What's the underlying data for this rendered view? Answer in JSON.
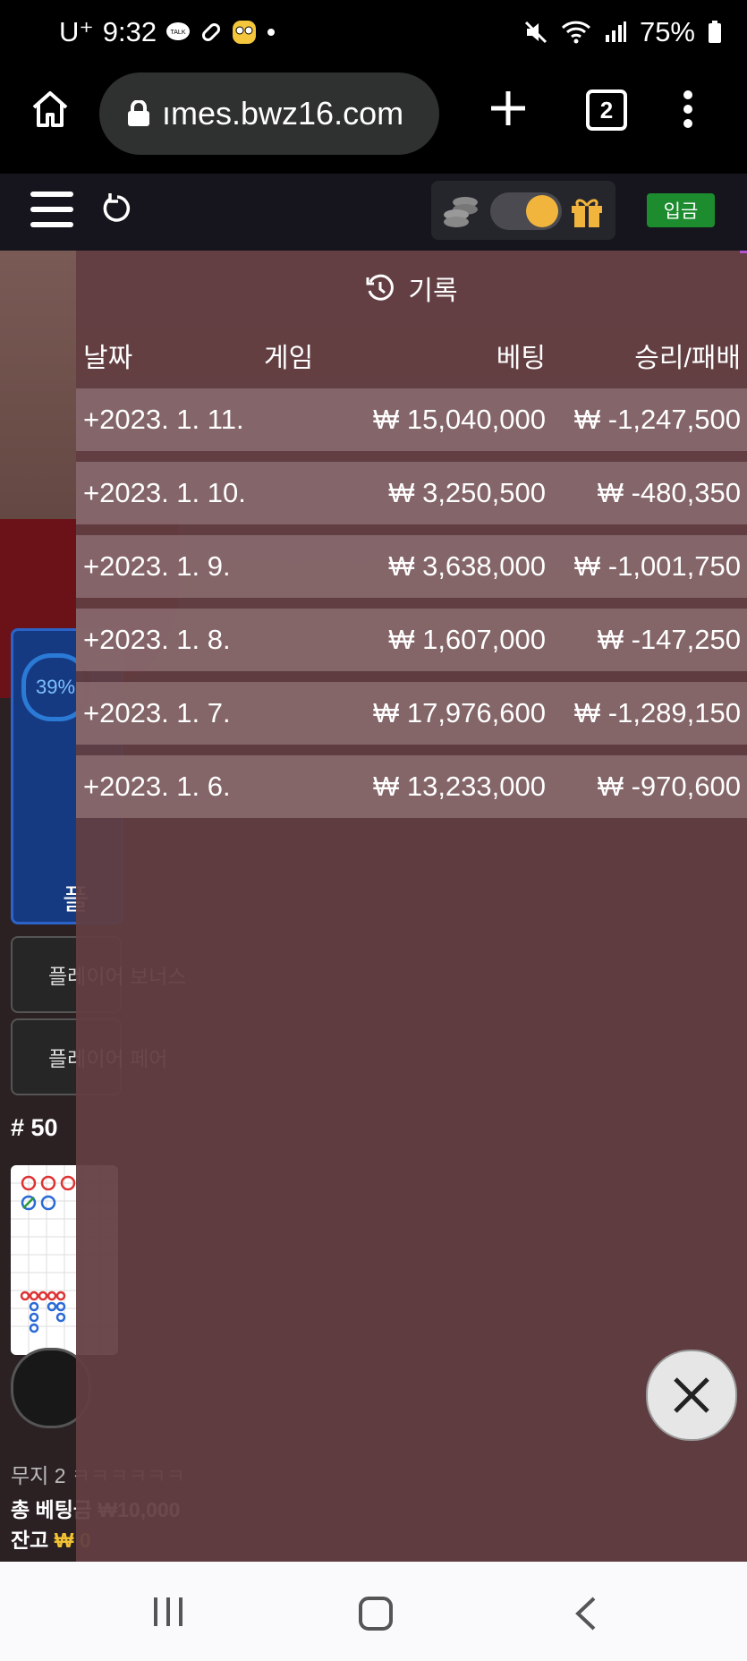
{
  "status_bar": {
    "carrier": "U⁺",
    "time": "9:32",
    "battery": "75%",
    "icons_left": [
      "talk-icon",
      "pill-icon",
      "emoji-icon",
      "dot-icon"
    ],
    "icons_right": [
      "mute-icon",
      "wifi-icon",
      "signal-icon",
      "battery-icon"
    ]
  },
  "browser": {
    "url": "ımes.bwz16.com",
    "tab_count": "2"
  },
  "game_header": {
    "deposit_label": "입금"
  },
  "history": {
    "title": "기록",
    "columns": [
      "날짜",
      "게임",
      "베팅",
      "승리/패배"
    ],
    "rows": [
      {
        "date": "+2023. 1. 11.",
        "bet": "₩ 15,040,000",
        "result": "₩ -1,247,500"
      },
      {
        "date": "+2023. 1. 10.",
        "bet": "₩ 3,250,500",
        "result": "₩ -480,350"
      },
      {
        "date": "+2023. 1. 9.",
        "bet": "₩ 3,638,000",
        "result": "₩ -1,001,750"
      },
      {
        "date": "+2023. 1. 8.",
        "bet": "₩ 1,607,000",
        "result": "₩ -147,250"
      },
      {
        "date": "+2023. 1. 7.",
        "bet": "₩ 17,976,600",
        "result": "₩ -1,289,150"
      },
      {
        "date": "+2023. 1. 6.",
        "bet": "₩ 13,233,000",
        "result": "₩ -970,600"
      }
    ]
  },
  "background_game": {
    "progress": "39%",
    "player_label": "플",
    "player_bonus": "플레이어 보너스",
    "player_pair": "플레이어 페어",
    "round": "# 50",
    "muji_text": "무지 2 ㅋㅋㅋㅋㅋㅋ",
    "total_bet": "총 베팅금 ₩10,000",
    "balance_label": "잔고",
    "balance_value": "₩ 0"
  }
}
